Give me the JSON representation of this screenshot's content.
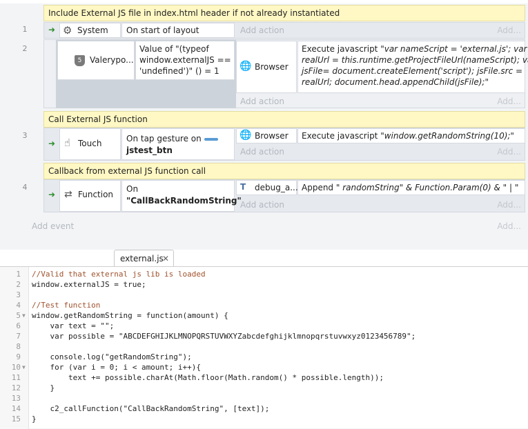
{
  "events": {
    "comments": [
      "Include External JS file in index.html header if not already instantiated",
      "Call External JS function",
      "Callback from external JS function call"
    ],
    "line_numbers": [
      "1",
      "2",
      "3",
      "4"
    ],
    "add_action_label": "Add action",
    "add_more_label": "Add...",
    "add_event_label": "Add event",
    "event1": {
      "object": "System",
      "condition": "On start of layout",
      "object_icon": "gear-icon"
    },
    "event2": {
      "object": "Valerypo...",
      "object_icon": "html5-icon",
      "condition_lines": [
        "Value of \"(typeof",
        "window.externalJS ==",
        "'undefined')\" () = 1"
      ],
      "action_object": "Browser",
      "action_prefix": "Execute javascript ",
      "action_lines": [
        "\"var nameScript = 'external.js'; var",
        "realUrl = this.runtime.getProjectFileUrl(nameScript); var",
        "jsFile= document.createElement('script'); jsFile.src =",
        "realUrl; document.head.appendChild(jsFile);\""
      ]
    },
    "event3": {
      "object": "Touch",
      "object_icon": "touch-hand-icon",
      "condition_prefix": "On tap gesture on",
      "condition_target": "jstest_btn",
      "action_object": "Browser",
      "action_prefix": "Execute javascript ",
      "action_value": "\"window.getRandomString(10);\""
    },
    "event4": {
      "object": "Function",
      "object_icon": "function-arrows-icon",
      "condition_prefix": "On",
      "condition_target": "\"CallBackRandomString\"",
      "action_object": "debug_a...",
      "action_prefix": "Append ",
      "action_value": "\" randomString\" & Function.Param(0) & \" | \""
    }
  },
  "editor": {
    "tab_label": "external.js",
    "code_lines": [
      "//Valid that external js lib is loaded",
      "window.externalJS = true;",
      "",
      "//Test function",
      "window.getRandomString = function(amount) {",
      "    var text = \"\";",
      "    var possible = \"ABCDEFGHIJKLMNOPQRSTUVWXYZabcdefghijklmnopqrstuvwxyz0123456789\";",
      "",
      "    console.log(\"getRandomString\");",
      "    for (var i = 0; i < amount; i++){",
      "        text += possible.charAt(Math.floor(Math.random() * possible.length));",
      "    }",
      "",
      "    c2_callFunction(\"CallBackRandomString\", [text]);",
      "}"
    ],
    "gutter_numbers": [
      "1",
      "2",
      "3",
      "4",
      "5",
      "6",
      "7",
      "8",
      "9",
      "10",
      "11",
      "12",
      "13",
      "14",
      "15"
    ]
  }
}
